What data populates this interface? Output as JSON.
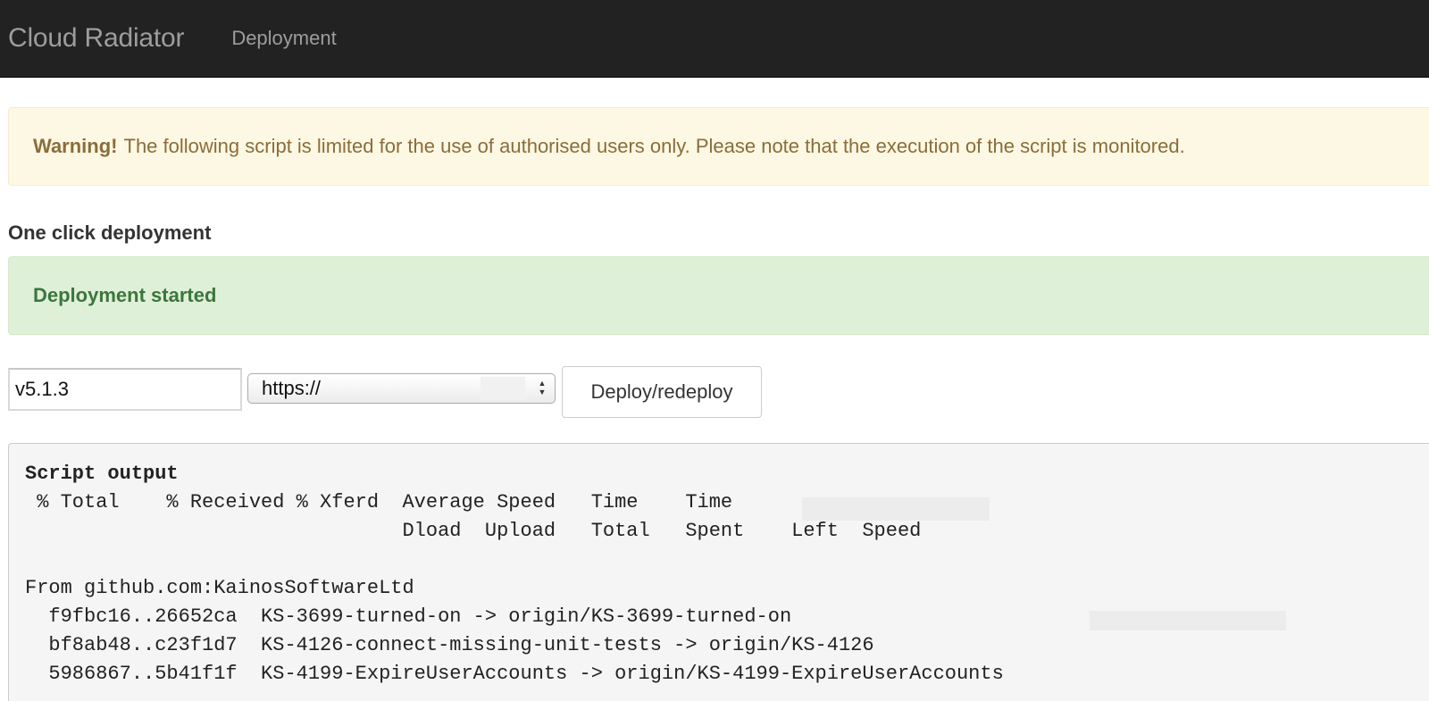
{
  "navbar": {
    "brand": "Cloud Radiator",
    "links": [
      "Deployment"
    ]
  },
  "warning": {
    "strong": "Warning!",
    "text": "The following script is limited for the use of authorised users only. Please note that the execution of the script is monitored."
  },
  "section_title": "One click deployment",
  "success_message": "Deployment started",
  "form": {
    "version_value": "v5.1.3",
    "url_selected": "https://",
    "deploy_label": "Deploy/redeploy"
  },
  "output": {
    "title": "Script output",
    "lines": [
      " % Total    % Received % Xferd  Average Speed   Time    Time",
      "                                Dload  Upload   Total   Spent    Left  Speed",
      "",
      "From github.com:KainosSoftwareLtd",
      "  f9fbc16..26652ca  KS-3699-turned-on -> origin/KS-3699-turned-on",
      "  bf8ab48..c23f1d7  KS-4126-connect-missing-unit-tests -> origin/KS-4126",
      "  5986867..5b41f1f  KS-4199-ExpireUserAccounts -> origin/KS-4199-ExpireUserAccounts"
    ]
  },
  "colors": {
    "navbar_bg": "#222222",
    "warning_bg": "#fcf8e3",
    "warning_text": "#8a6d3b",
    "success_bg": "#dff0d8",
    "success_text": "#3c763d",
    "output_bg": "#f5f5f5"
  }
}
